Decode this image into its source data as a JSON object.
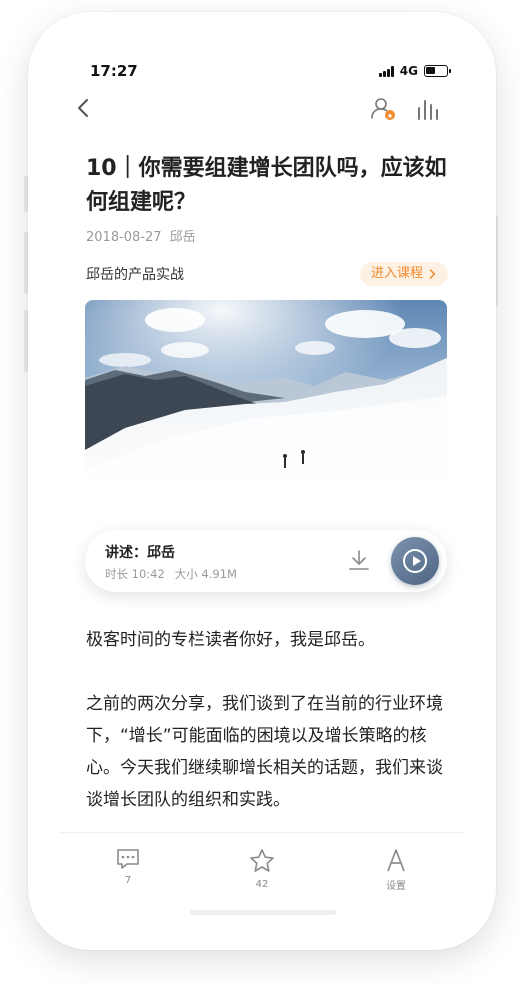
{
  "status": {
    "time": "17:27",
    "network": "4G",
    "battery_level": 0.45
  },
  "nav": {
    "back_icon": "chevron-left-icon",
    "author_icon": "user-badge-icon",
    "chart_icon": "bar-chart-icon"
  },
  "article": {
    "title": "10｜你需要组建增长团队吗，应该如何组建呢？",
    "date": "2018-08-27",
    "author": "邱岳",
    "course_name": "邱岳的产品实战",
    "course_button": "进入课程",
    "paragraphs": [
      "极客时间的专栏读者你好，我是邱岳。",
      "之前的两次分享，我们谈到了在当前的行业环境下，“增长”可能面临的困境以及增长策略的核心。今天我们继续聊增长相关的话题，我们来谈谈增长团队的组织和实践。"
    ]
  },
  "audio": {
    "narrator": "讲述：邱岳",
    "duration": "时长 10:42",
    "size": "大小 4.91M"
  },
  "toolbar": {
    "comments_count": "7",
    "stars_count": "42",
    "settings_label": "设置"
  },
  "colors": {
    "accent_orange": "#f08a2c",
    "play_blue": "#5f7896",
    "course_bg": "#fdf1e4"
  }
}
